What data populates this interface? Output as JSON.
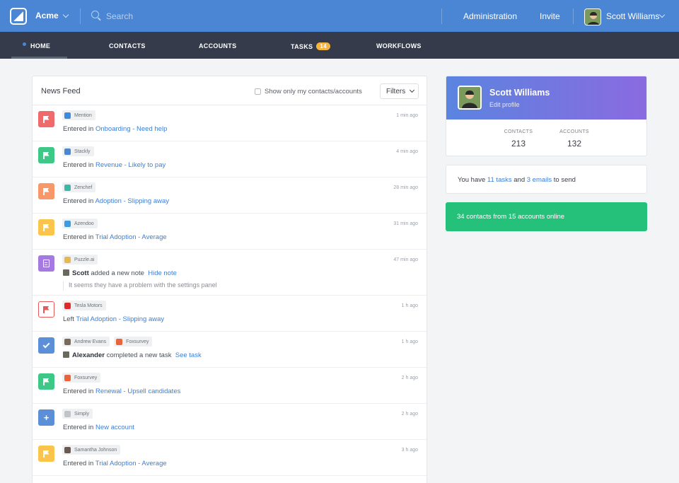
{
  "topbar": {
    "org_name": "Acme",
    "search_placeholder": "Search",
    "administration": "Administration",
    "invite": "Invite",
    "user_name": "Scott Williams",
    "brand_color": "#4a86d4"
  },
  "nav": {
    "home": "HOME",
    "contacts": "CONTACTS",
    "accounts": "ACCOUNTS",
    "tasks": "TASKS",
    "tasks_badge": "14",
    "workflows": "WORKFLOWS",
    "active_tab": "HOME"
  },
  "feed": {
    "title": "News Feed",
    "show_only_label": "Show only my contacts/accounts",
    "filters_label": "Filters",
    "items": [
      {
        "icon": "flag-icon",
        "color": "#ef6b6b",
        "tags": [
          {
            "label": "Mention",
            "color": "#3d8be0"
          }
        ],
        "prefix": "Entered in",
        "link": "Onboarding - Need help",
        "time": "1 min ago"
      },
      {
        "icon": "flag-icon",
        "color": "#3dc887",
        "tags": [
          {
            "label": "Stackly",
            "color": "#4a86d4"
          }
        ],
        "prefix": "Entered in",
        "link": "Revenue - Likely to pay",
        "time": "4 min ago"
      },
      {
        "icon": "flag-icon",
        "color": "#f7976a",
        "tags": [
          {
            "label": "Zenchef",
            "color": "#3cb8a8"
          }
        ],
        "prefix": "Entered in",
        "link": "Adoption - Slipping away",
        "time": "28 min ago"
      },
      {
        "icon": "flag-icon",
        "color": "#fbc54d",
        "tags": [
          {
            "label": "Azendoo",
            "color": "#3d9be0"
          }
        ],
        "prefix": "Entered in",
        "link": "Trial Adoption - Average",
        "time": "31 min ago"
      },
      {
        "icon": "note-icon",
        "color": "#a57ae0",
        "tags": [
          {
            "label": "Puzzle.ai",
            "color": "#e8b84a"
          }
        ],
        "actor": "Scott",
        "action": "added a new note",
        "link": "Hide note",
        "quote": "It seems they have a problem with the settings panel",
        "time": "47 min ago"
      },
      {
        "icon": "flag-icon",
        "color": "#e85a5a",
        "outlined": true,
        "tags": [
          {
            "label": "Tesla Motors",
            "color": "#e02a2a"
          }
        ],
        "prefix": "Left",
        "link": "Trial Adoption - Slipping away",
        "time": "1 h ago"
      },
      {
        "icon": "check-icon",
        "color": "#5b8fd8",
        "tags": [
          {
            "label": "Andrew Evans",
            "color": "#7a6a5a"
          },
          {
            "label": "Foxsurvey",
            "color": "#e8643c"
          }
        ],
        "actor": "Alexander",
        "action": "completed a new task",
        "link": "See task",
        "time": "1 h ago"
      },
      {
        "icon": "flag-icon",
        "color": "#3dc887",
        "tags": [
          {
            "label": "Foxsurvey",
            "color": "#e8643c"
          }
        ],
        "prefix": "Entered in",
        "link": "Renewal - Upsell candidates",
        "time": "2 h ago"
      },
      {
        "icon": "plus-icon",
        "color": "#5b8fd8",
        "tags": [
          {
            "label": "Simply",
            "color": "#c0c4ca"
          }
        ],
        "prefix": "Entered in",
        "link": "New account",
        "time": "2 h ago"
      },
      {
        "icon": "flag-icon",
        "color": "#fbc54d",
        "tags": [
          {
            "label": "Samantha Johnson",
            "color": "#6a5a52"
          }
        ],
        "prefix": "Entered in",
        "link": "Trial Adoption - Average",
        "time": "3 h ago"
      }
    ]
  },
  "profile": {
    "name": "Scott Williams",
    "edit_label": "Edit profile",
    "contacts_label": "CONTACTS",
    "contacts_value": "213",
    "accounts_label": "ACCOUNTS",
    "accounts_value": "132"
  },
  "tasks_summary": {
    "text_before": "You have",
    "tasks_link": "11 tasks",
    "text_middle": "and",
    "emails_link": "3 emails",
    "text_after": "to send"
  },
  "online": {
    "text": "34 contacts from 15 accounts online",
    "color": "#25c07a"
  }
}
